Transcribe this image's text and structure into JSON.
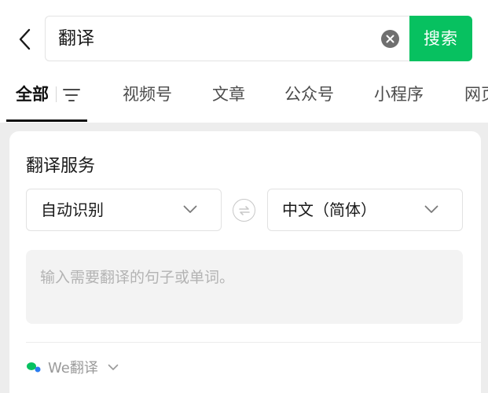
{
  "search": {
    "query": "翻译",
    "button_label": "搜索"
  },
  "tabs": [
    {
      "label": "全部",
      "active": true
    },
    {
      "label": "视频号"
    },
    {
      "label": "文章"
    },
    {
      "label": "公众号"
    },
    {
      "label": "小程序"
    },
    {
      "label": "网页"
    }
  ],
  "card": {
    "title": "翻译服务",
    "source_lang": "自动识别",
    "target_lang": "中文（简体）",
    "input_placeholder": "输入需要翻译的句子或单词。",
    "provider": "We翻译"
  },
  "colors": {
    "accent": "#07c160",
    "provider_dot_green": "#07c160",
    "provider_dot_blue": "#2b7cf0"
  },
  "icons": {
    "back": "chevron-left-icon",
    "clear": "clear-icon",
    "filter": "filter-icon",
    "swap": "swap-icon",
    "dropdown": "chevron-down-icon"
  }
}
